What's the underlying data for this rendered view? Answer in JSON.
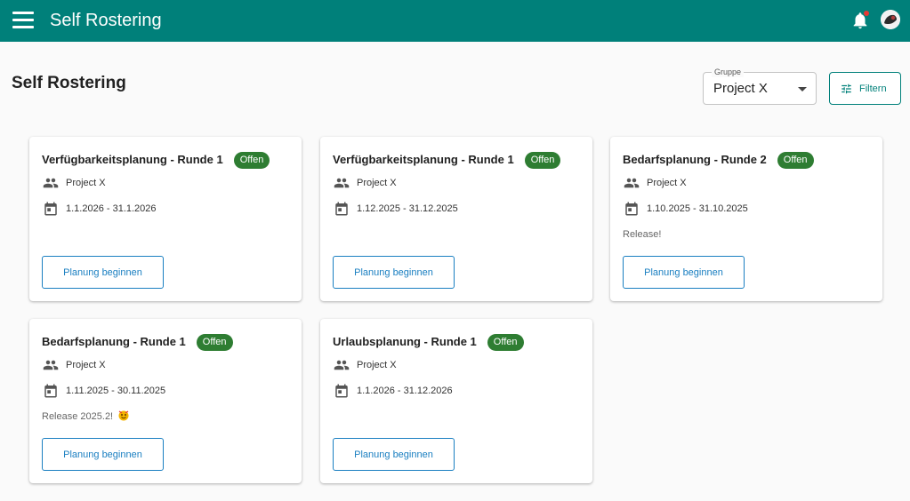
{
  "appbar": {
    "title": "Self Rostering",
    "accent": "#00807a"
  },
  "page": {
    "title": "Self Rostering"
  },
  "group_filter": {
    "legend": "Gruppe",
    "value": "Project X"
  },
  "filter_button": {
    "label": "Filtern"
  },
  "colors": {
    "badge_open": "#2e7d32",
    "button_outline": "#1a7fc1",
    "notification_dot": "#e53935"
  },
  "icons": [
    "menu-icon",
    "bell-icon",
    "avatar",
    "group-icon",
    "calendar-icon",
    "tune-icon",
    "chevron-down-icon",
    "party-emoji"
  ],
  "cards": [
    {
      "title": "Verfügbarkeitsplanung - Runde 1",
      "status": "Offen",
      "group": "Project X",
      "dates": "1.1.2026 - 31.1.2026",
      "note": "",
      "button": "Planung beginnen"
    },
    {
      "title": "Verfügbarkeitsplanung - Runde 1",
      "status": "Offen",
      "group": "Project X",
      "dates": "1.12.2025 - 31.12.2025",
      "note": "",
      "button": "Planung beginnen"
    },
    {
      "title": "Bedarfsplanung - Runde 2",
      "status": "Offen",
      "group": "Project X",
      "dates": "1.10.2025 - 31.10.2025",
      "note": "Release!",
      "button": "Planung beginnen"
    },
    {
      "title": "Bedarfsplanung - Runde 1",
      "status": "Offen",
      "group": "Project X",
      "dates": "1.11.2025 - 30.11.2025",
      "note": "Release 2025.2!",
      "note_emoji": "party-emoji",
      "button": "Planung beginnen"
    },
    {
      "title": "Urlaubsplanung - Runde 1",
      "status": "Offen",
      "group": "Project X",
      "dates": "1.1.2026 - 31.12.2026",
      "note": "",
      "button": "Planung beginnen"
    }
  ]
}
